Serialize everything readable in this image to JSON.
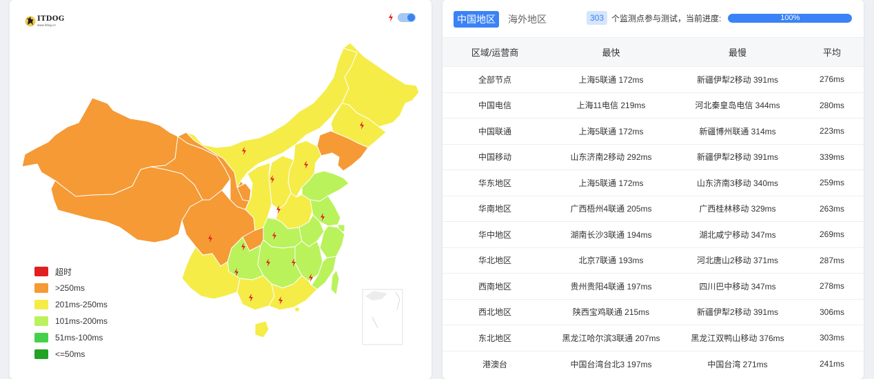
{
  "logo": {
    "text": "ITDOG",
    "subtext": "www.itdog.cn"
  },
  "map_toggle": {
    "on": true,
    "icon": "lightning-icon"
  },
  "legend": [
    {
      "label": "超时",
      "color": "#e02020"
    },
    {
      "label": ">250ms",
      "color": "#f59a35"
    },
    {
      "label": "201ms-250ms",
      "color": "#f5ec48"
    },
    {
      "label": "101ms-200ms",
      "color": "#baf25c"
    },
    {
      "label": "51ms-100ms",
      "color": "#44d14a"
    },
    {
      "label": "<=50ms",
      "color": "#22a325"
    }
  ],
  "tabs": [
    {
      "label": "中国地区",
      "active": true
    },
    {
      "label": "海外地区",
      "active": false
    }
  ],
  "progress": {
    "count": "303",
    "text": "个监测点参与测试，当前进度:",
    "percent_label": "100%",
    "value": 1.0
  },
  "table": {
    "headers": [
      "区域/运营商",
      "最快",
      "最慢",
      "平均"
    ],
    "rows": [
      [
        "全部节点",
        "上海5联通 172ms",
        "新疆伊犁2移动 391ms",
        "276ms"
      ],
      [
        "中国电信",
        "上海11电信 219ms",
        "河北秦皇岛电信 344ms",
        "280ms"
      ],
      [
        "中国联通",
        "上海5联通 172ms",
        "新疆博州联通 314ms",
        "223ms"
      ],
      [
        "中国移动",
        "山东济南2移动 292ms",
        "新疆伊犁2移动 391ms",
        "339ms"
      ],
      [
        "华东地区",
        "上海5联通 172ms",
        "山东济南3移动 340ms",
        "259ms"
      ],
      [
        "华南地区",
        "广西梧州4联通 205ms",
        "广西桂林移动 329ms",
        "263ms"
      ],
      [
        "华中地区",
        "湖南长沙3联通 194ms",
        "湖北咸宁移动 347ms",
        "269ms"
      ],
      [
        "华北地区",
        "北京7联通 193ms",
        "河北唐山2移动 371ms",
        "287ms"
      ],
      [
        "西南地区",
        "贵州贵阳4联通 197ms",
        "四川巴中移动 347ms",
        "278ms"
      ],
      [
        "西北地区",
        "陕西宝鸡联通 215ms",
        "新疆伊犁2移动 391ms",
        "306ms"
      ],
      [
        "东北地区",
        "黑龙江哈尔滨3联通 207ms",
        "黑龙江双鸭山移动 376ms",
        "303ms"
      ],
      [
        "港澳台",
        "中国台湾台北3 197ms",
        "中国台湾 271ms",
        "241ms"
      ]
    ]
  }
}
